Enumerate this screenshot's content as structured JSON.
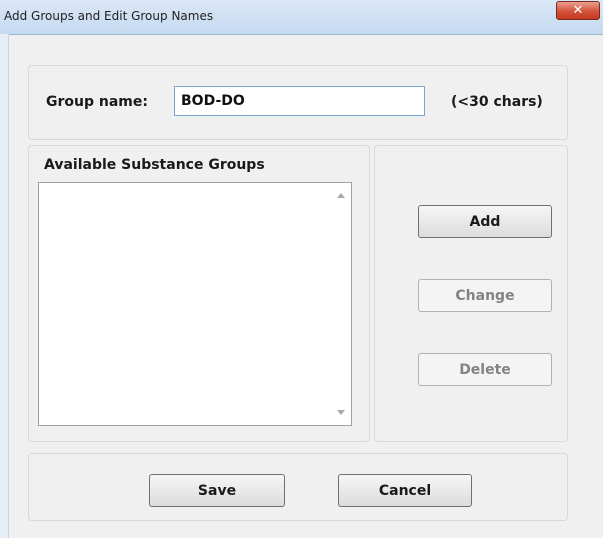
{
  "window": {
    "title": "Add Groups and Edit Group Names",
    "close_glyph": "✕"
  },
  "group_name": {
    "label": "Group name:",
    "value": "BOD-DO",
    "hint": "(<30 chars)"
  },
  "substances": {
    "label": "Available Substance Groups",
    "items": []
  },
  "actions": {
    "add_label": "Add",
    "change_label": "Change",
    "delete_label": "Delete"
  },
  "footer": {
    "save_label": "Save",
    "cancel_label": "Cancel"
  }
}
